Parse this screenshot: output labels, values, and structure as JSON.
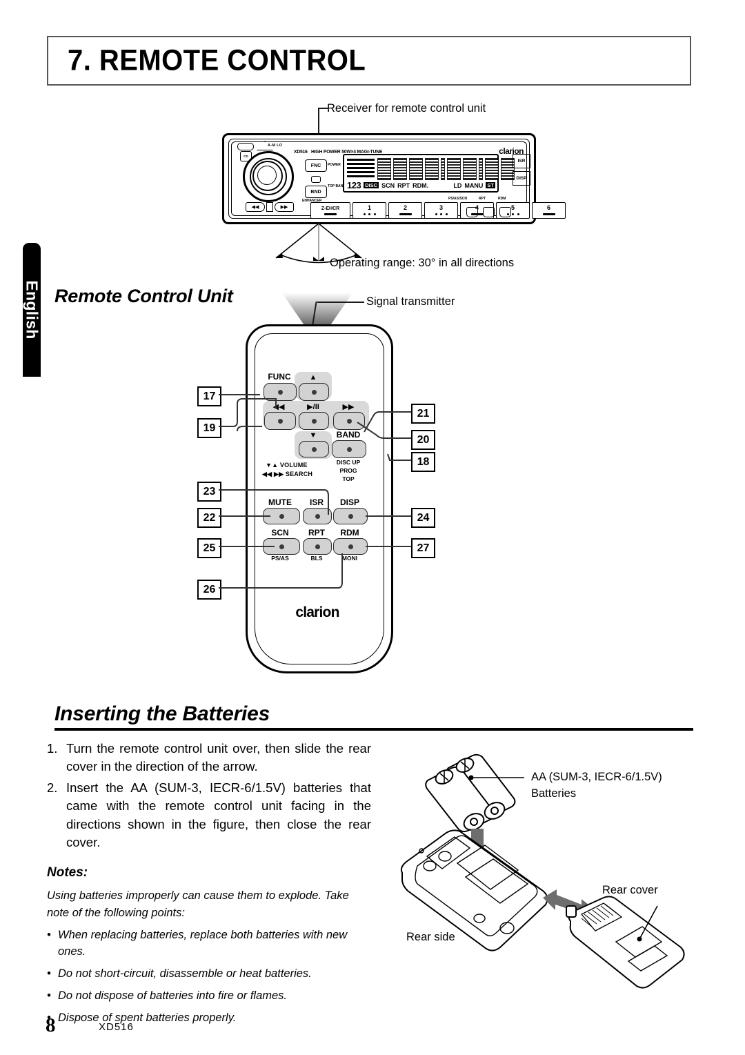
{
  "chapter": {
    "title": "7. REMOTE CONTROL"
  },
  "side_tab": {
    "label": "English"
  },
  "head_unit": {
    "receiver_caption": "Receiver for remote control unit",
    "operating_range_caption": "Operating range: 30° in all directions",
    "brand": "clarion",
    "model": "XD516",
    "spec_text": "HIGH POWER 50W×4  MAGI-TUNE",
    "am_lo": "A-M LO",
    "cd_button": "CD",
    "fnc_button": "FNC",
    "bnd_button": "BND",
    "fnc_side_label": "POWER",
    "bnd_side_label": "TOP BAND",
    "enhancer_label": "ENHANCER",
    "isr_button": "ISR",
    "disp_button": "DISP",
    "z_enhancer": "Z-EHCR",
    "presets": [
      "1",
      "2",
      "3",
      "4",
      "5",
      "6"
    ],
    "right_tiny_labels": [
      "PS/AS/SCN",
      "RPT",
      "RDM"
    ],
    "lcd": {
      "indicators_left": "123",
      "disc": "DISC",
      "scn": "SCN",
      "rpt": "RPT",
      "rdm": "RDM.",
      "ld": "LD",
      "manu": "MANU",
      "st": "ST"
    }
  },
  "remote": {
    "section_heading": "Remote Control Unit",
    "signal_transmitter_caption": "Signal transmitter",
    "brand": "clarion",
    "keys": {
      "func": "FUNC",
      "up": "▲",
      "down": "▼",
      "rew": "◀◀",
      "play_pause": "▶/II",
      "ff": "▶▶",
      "band": "BAND",
      "mute": "MUTE",
      "isr": "ISR",
      "disp": "DISP",
      "scn": "SCN",
      "rpt": "RPT",
      "rdm": "RDM"
    },
    "sub_labels": {
      "band_sub": [
        "DISC UP",
        "PROG",
        "TOP"
      ],
      "scn_sub": "PS/AS",
      "rpt_sub": "BLS",
      "rdm_sub": "MONI"
    },
    "legend": {
      "volume": "▼▲  VOLUME",
      "search": "◀◀ ▶▶  SEARCH"
    },
    "callouts_left": [
      "17",
      "19",
      "23",
      "22",
      "25",
      "26"
    ],
    "callouts_right": [
      "21",
      "20",
      "18",
      "24",
      "27"
    ]
  },
  "batteries_section": {
    "heading": "Inserting the Batteries",
    "steps": [
      {
        "num": "1.",
        "text": "Turn the remote control unit over, then slide the rear cover in the direction of the arrow."
      },
      {
        "num": "2.",
        "text": "Insert the AA (SUM-3, IECR-6/1.5V) batteries that came with the remote control unit facing in the directions shown in the figure, then close the rear cover."
      }
    ],
    "notes_heading": "Notes:",
    "notes_intro": "Using batteries improperly can cause them to explode. Take note of the following points:",
    "notes_bullets": [
      "When replacing batteries, replace both batteries with new ones.",
      "Do not short-circuit, disassemble or heat batteries.",
      "Do not dispose of batteries into fire or flames.",
      "Dispose of spent batteries properly."
    ],
    "diagram_labels": {
      "batteries": "AA (SUM-3, IECR-6/1.5V)\nBatteries",
      "batteries_line1": "AA (SUM-3, IECR-6/1.5V)",
      "batteries_line2": "Batteries",
      "rear_cover": "Rear cover",
      "rear_side": "Rear side"
    }
  },
  "footer": {
    "page_number": "8",
    "model": "XD516"
  }
}
